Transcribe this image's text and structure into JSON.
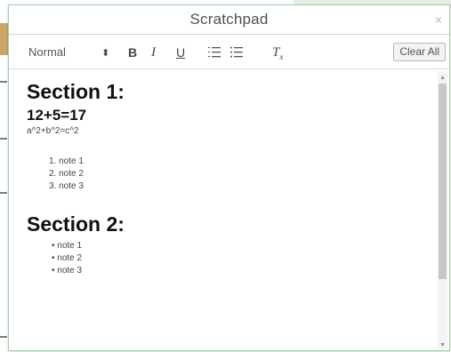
{
  "dialog": {
    "title": "Scratchpad",
    "close_glyph": "×"
  },
  "toolbar": {
    "format_value": "Normal",
    "format_arrows": "⬍",
    "bold_label": "B",
    "italic_label": "I",
    "underline_label": "U",
    "ordered_list_icon": "ordered-list-icon",
    "bullet_list_icon": "bullet-list-icon",
    "clear_format_label": "Tx",
    "clear_all_label": "Clear All"
  },
  "content": {
    "section1": "Section 1:",
    "equation": "12+5=17",
    "formula": "a^2+b^2=c^2",
    "ordered": [
      "1. note 1",
      "2. note 2",
      "3. note 3"
    ],
    "section2": "Section 2:",
    "bullets": [
      "• note 1",
      "• note 2",
      "• note 3"
    ]
  },
  "colors": {
    "dialog_border": "#9fd1a0",
    "accent_strip": "#c8a768"
  }
}
